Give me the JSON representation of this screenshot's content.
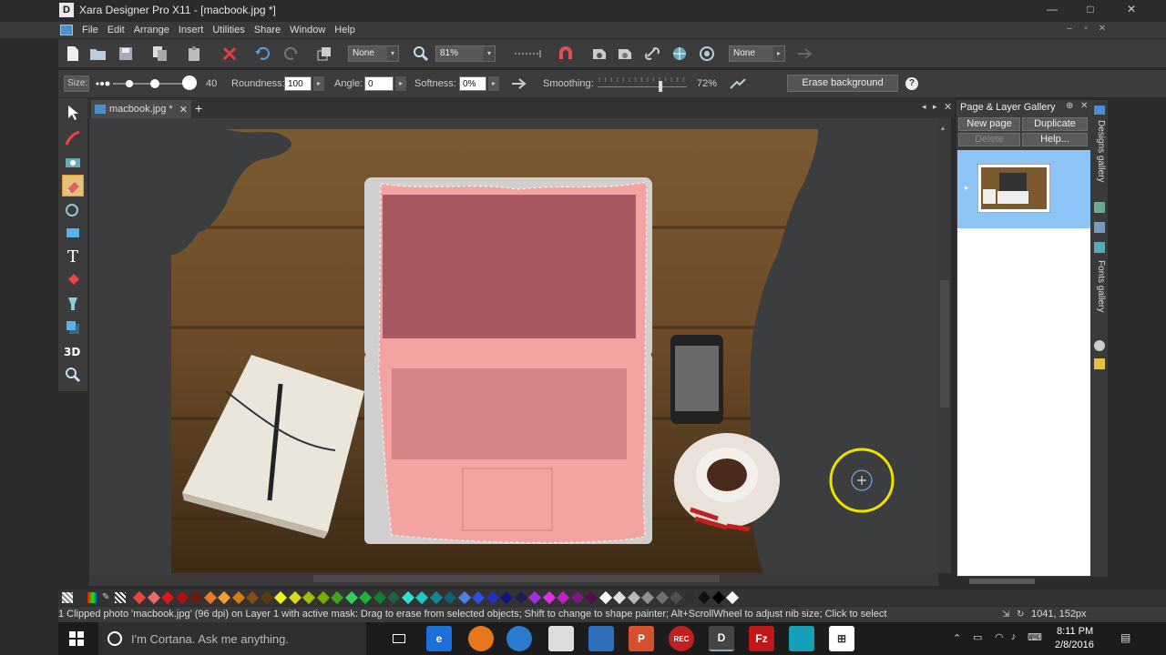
{
  "window": {
    "app_logo": "D",
    "title": "Xara Designer Pro X11 - [macbook.jpg *]",
    "controls": [
      "—",
      "□",
      "✕"
    ]
  },
  "menu": {
    "items": [
      "File",
      "Edit",
      "Arrange",
      "Insert",
      "Utilities",
      "Share",
      "Window",
      "Help"
    ]
  },
  "toolbar1": {
    "quality_select": "None",
    "zoom_select": "81%",
    "style_select": "None"
  },
  "toolbar2": {
    "size_label": "Size:",
    "size_value": "40",
    "roundness_label": "Roundness:",
    "roundness_value": "100",
    "angle_label": "Angle:",
    "angle_value": "0",
    "softness_label": "Softness:",
    "softness_value": "0%",
    "smoothing_label": "Smoothing:",
    "smoothing_value": "72%",
    "smoothing_level": 0.72,
    "erase_background_label": "Erase background",
    "help_label": "?"
  },
  "tools": [
    "selector-icon",
    "freehand-icon",
    "photo-icon",
    "eraser-icon",
    "contour-icon",
    "rectangle-icon",
    "text-icon",
    "fill-icon",
    "transparency-icon",
    "shadow-icon",
    "3d-icon",
    "zoom-icon"
  ],
  "document": {
    "tab_label": "macbook.jpg *"
  },
  "gallery": {
    "title": "Page & Layer Gallery",
    "new_page": "New page",
    "duplicate": "Duplicate",
    "delete": "Delete",
    "help": "Help...",
    "side_tabs": [
      "Designs gallery",
      "Fonts gallery"
    ]
  },
  "palette": {
    "colors": [
      "#e8463c",
      "#f06a6a",
      "#d81c1c",
      "#b01010",
      "#6a1a0a",
      "#e87a28",
      "#f0a030",
      "#d08018",
      "#805018",
      "#5a3a10",
      "#f0f020",
      "#d8d820",
      "#a0c010",
      "#70b000",
      "#40a020",
      "#30d060",
      "#20b040",
      "#108030",
      "#206040",
      "#30e0d0",
      "#20c8c8",
      "#108898",
      "#106070",
      "#5080e0",
      "#3050e0",
      "#2030c0",
      "#101880",
      "#202050",
      "#a030e0",
      "#e030e0",
      "#c020c0",
      "#801880",
      "#501050",
      "#ffffff",
      "#e0e0e0",
      "#b8b8b8",
      "#909090",
      "#707070",
      "#505050",
      "#303030",
      "#101010",
      "#000000",
      "#f8f8f8"
    ]
  },
  "status": {
    "text": "1 Clipped photo 'macbook.jpg' (96 dpi) on Layer 1 with active mask: Drag to erase from selected objects; Shift to change to shape painter; Alt+ScrollWheel to adjust nib size; Click to select",
    "coords": "1041, 152px"
  },
  "taskbar": {
    "search_placeholder": "I'm Cortana. Ask me anything.",
    "time": "8:11 PM",
    "date": "2/8/2016",
    "apps": [
      "task-view",
      "edge",
      "firefox",
      "chrome",
      "paint",
      "word",
      "powerpoint",
      "record",
      "xara",
      "filezilla",
      "store",
      "windows-store"
    ]
  }
}
